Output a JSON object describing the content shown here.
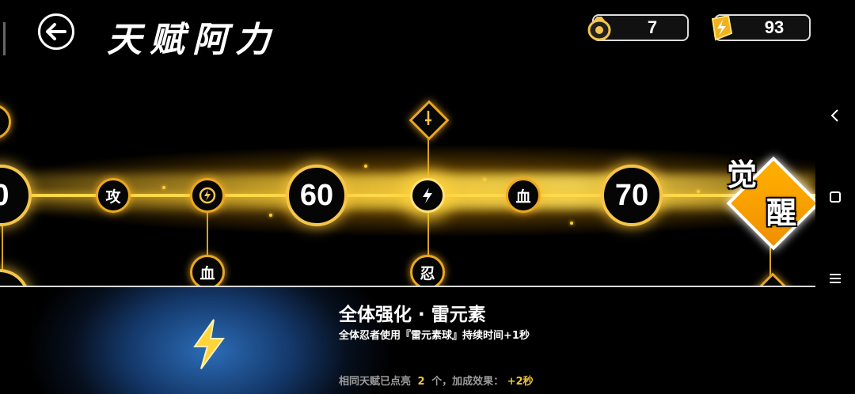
{
  "header": {
    "title": "天赋阿力",
    "coins": "7",
    "energy": "93"
  },
  "path": {
    "milestones": [
      "0",
      "60",
      "70"
    ],
    "nodes": {
      "attack": "攻",
      "blood_lower": "血",
      "blood_right": "血",
      "ninja": "忍"
    },
    "awaken": [
      "觉",
      "醒"
    ]
  },
  "detail": {
    "name": "全体强化 · 雷元素",
    "description": "全体忍者使用『雷元素球』持续时间+1秒",
    "stat_prefix": "相同天赋已点亮",
    "stat_count": "2",
    "stat_middle": "个，加成效果：",
    "stat_value": "+2秒"
  },
  "colors": {
    "gold": "#f4c54a",
    "accent": "#f3c531",
    "panel_blue": "#2c6db8"
  },
  "icons": {
    "back": "back-arrow-icon",
    "coin": "coin-bag-icon",
    "energy": "lightning-crystal-icon",
    "lightning": "lightning-icon"
  }
}
